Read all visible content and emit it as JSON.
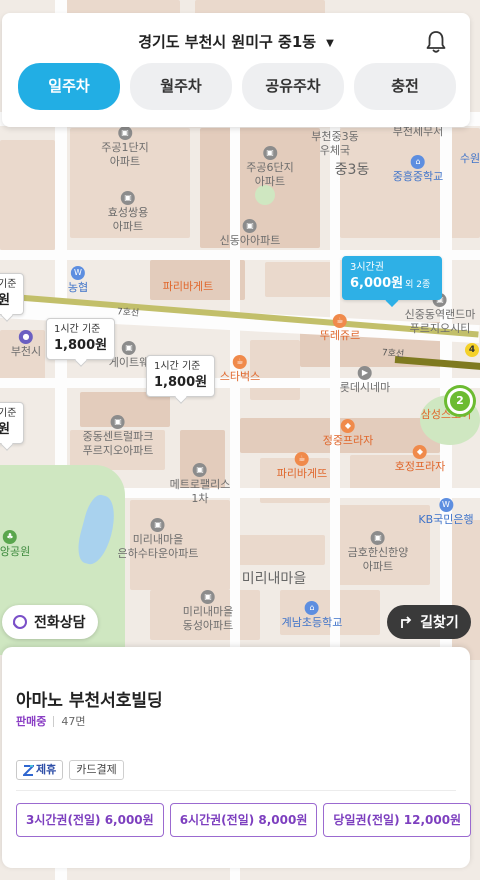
{
  "header": {
    "location": "경기도 부천시 원미구 중1동",
    "tabs": [
      {
        "label": "일주차",
        "active": true
      },
      {
        "label": "월주차",
        "active": false
      },
      {
        "label": "공유주차",
        "active": false
      },
      {
        "label": "충전",
        "active": false
      }
    ]
  },
  "map": {
    "pois": {
      "apt1": "주공1단지\n아파트",
      "apt6": "주공6단지\n아파트",
      "hyosung": "효성쌍용\n아파트",
      "sindong": "신동아아파트",
      "office": "부천중3동\n우체국",
      "jung3": "중3동",
      "junghung": "중흥중학교",
      "taxoffice": "부천세무서",
      "suwon": "수원",
      "nonghyup": "농협",
      "paris1": "파리바게트",
      "tous": "뚜레쥬르",
      "starbucks": "스타벅스",
      "lotte": "롯데시네마",
      "jungjung": "정중프라자",
      "paris2": "파리바게뜨",
      "sinjung": "신중동역랜드마\n푸르지오시티",
      "samsung": "삼성스토어",
      "hojeong": "호정프라자",
      "jungdong": "중동센트럴파크\n푸르지오아파트",
      "metro": "메트로팰리스\n1차",
      "kb": "KB국민은행",
      "mirinae1": "미리내마을\n은하수타운아파트",
      "geumho": "금호한신한양\n아파트",
      "mirinae": "미리내마을",
      "mirinae2": "미리내마을\n동성아파트",
      "gyenam": "계남초등학교",
      "park": "중앙공원",
      "bucheon": "부천시",
      "gate": "게이트웨",
      "line7a": "7호선",
      "line7b": "7호선"
    },
    "pins": [
      {
        "label": "3시간권",
        "price": "6,000원",
        "extra": "외 2종",
        "selected": true
      },
      {
        "label": "1시간 기준",
        "price": "1,800원",
        "selected": false
      },
      {
        "label": "1시간 기준",
        "price": "1,800원",
        "selected": false
      },
      {
        "label": "기준",
        "price": "원",
        "selected": false
      },
      {
        "label": "기준",
        "price": "원",
        "selected": false
      }
    ],
    "cluster_count": "2",
    "line_badge": "4"
  },
  "buttons": {
    "consult": "전화상담",
    "route": "길찾기"
  },
  "sheet": {
    "name": "아마노 부천서호빌딩",
    "status": "판매중",
    "spaces": "47면",
    "badges": {
      "partner": "제휴",
      "card": "카드결제"
    },
    "tickets": [
      "3시간권(전일) 6,000원",
      "6시간권(전일) 8,000원",
      "당일권(전일) 12,000원"
    ]
  },
  "colors": {
    "accent": "#22aee4",
    "purple": "#7d3fbf",
    "cluster": "#6cbb31"
  }
}
